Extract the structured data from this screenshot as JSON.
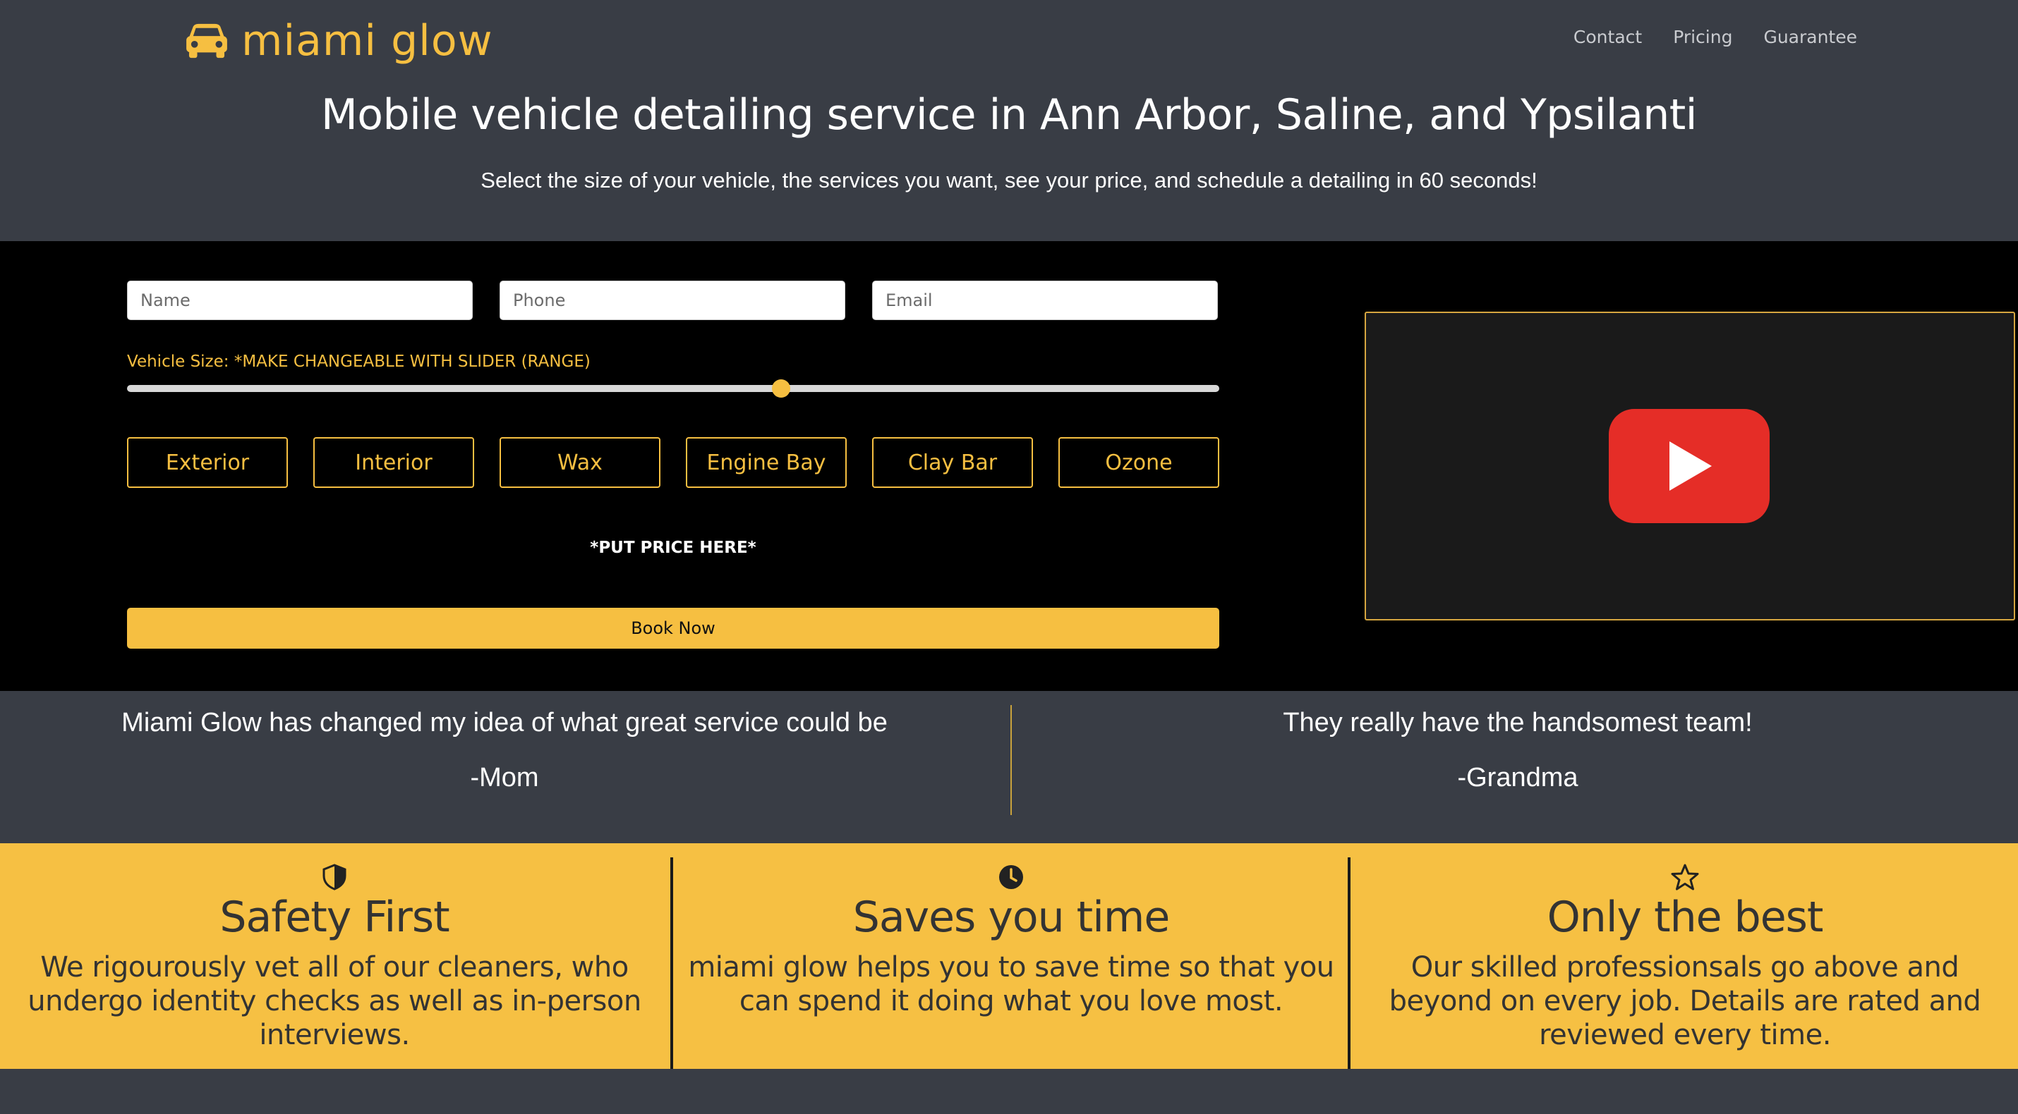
{
  "header": {
    "brand": "miami glow",
    "nav": [
      "Contact",
      "Pricing",
      "Guarantee"
    ],
    "title": "Mobile vehicle detailing service in Ann Arbor, Saline, and Ypsilanti",
    "subtitle": "Select the size of your vehicle, the services you want, see your price, and schedule a detailing in 60 seconds!"
  },
  "form": {
    "name_placeholder": "Name",
    "phone_placeholder": "Phone",
    "email_placeholder": "Email",
    "slider_label": "Vehicle Size: *MAKE CHANGEABLE WITH SLIDER (RANGE)",
    "slider_value_fraction": 0.6,
    "services": [
      "Exterior",
      "Interior",
      "Wax",
      "Engine Bay",
      "Clay Bar",
      "Ozone"
    ],
    "price_text": "*PUT PRICE HERE*",
    "book_label": "Book Now"
  },
  "video": {
    "icon": "youtube-play-icon"
  },
  "testimonials": [
    {
      "quote": "Miami Glow has changed my idea of what great service could be",
      "author": "-Mom"
    },
    {
      "quote": "They really have the handsomest team!",
      "author": "-Grandma"
    }
  ],
  "features": [
    {
      "icon": "shield-icon",
      "title": "Safety First",
      "text": "We rigourously vet all of our cleaners, who undergo identity checks as well as in-person interviews."
    },
    {
      "icon": "clock-icon",
      "title": "Saves you time",
      "text": "miami glow helps you to save time so that you can spend it doing what you love most."
    },
    {
      "icon": "star-icon",
      "title": "Only the best",
      "text": "Our skilled professionsals go above and beyond on every job. Details are rated and reviewed every time."
    }
  ],
  "colors": {
    "accent": "#f6bf41",
    "dark": "#393d45",
    "black": "#000000",
    "youtube": "#e52d27"
  }
}
